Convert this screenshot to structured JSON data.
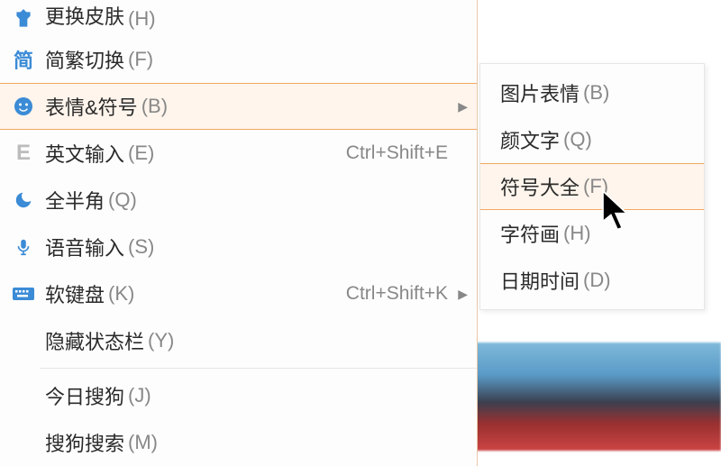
{
  "main_menu": {
    "items": [
      {
        "label": "更换皮肤",
        "key": "(H)",
        "icon": "skin"
      },
      {
        "label": "简繁切换",
        "key": "(F)",
        "icon": "jian"
      },
      {
        "label": "表情&符号",
        "key": "(B)",
        "icon": "smiley",
        "highlighted": true,
        "has_submenu": true
      },
      {
        "label": "英文输入",
        "key": "(E)",
        "icon": "E",
        "shortcut": "Ctrl+Shift+E"
      },
      {
        "label": "全半角",
        "key": "(Q)",
        "icon": "moon"
      },
      {
        "label": "语音输入",
        "key": "(S)",
        "icon": "mic"
      },
      {
        "label": "软键盘",
        "key": "(K)",
        "icon": "keyboard",
        "shortcut": "Ctrl+Shift+K",
        "has_submenu": true
      },
      {
        "label": "隐藏状态栏",
        "key": "(Y)"
      },
      {
        "label": "今日搜狗",
        "key": "(J)"
      },
      {
        "label": "搜狗搜索",
        "key": "(M)"
      }
    ]
  },
  "submenu": {
    "items": [
      {
        "label": "图片表情",
        "key": "(B)"
      },
      {
        "label": "颜文字",
        "key": "(Q)"
      },
      {
        "label": "符号大全",
        "key": "(F)",
        "highlighted": true
      },
      {
        "label": "字符画",
        "key": "(H)"
      },
      {
        "label": "日期时间",
        "key": "(D)"
      }
    ]
  }
}
